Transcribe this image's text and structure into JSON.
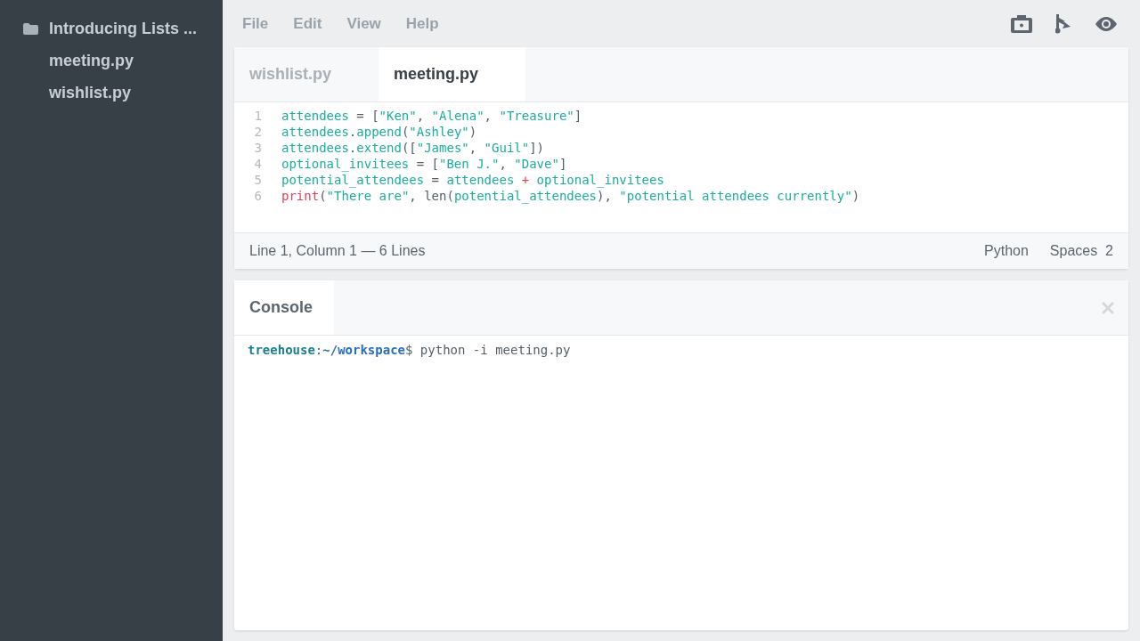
{
  "sidebar": {
    "folder": "Introducing Lists ...",
    "files": [
      {
        "label": "meeting.py",
        "selected": false
      },
      {
        "label": "wishlist.py",
        "selected": false
      }
    ]
  },
  "menu": [
    "File",
    "Edit",
    "View",
    "Help"
  ],
  "tabs": [
    {
      "label": "wishlist.py",
      "selected": false
    },
    {
      "label": "meeting.py",
      "selected": true
    }
  ],
  "code_lines": [
    {
      "number": "1",
      "tokens": [
        {
          "kind": "name",
          "text": "attendees"
        },
        {
          "kind": "punct",
          "text": " = ["
        },
        {
          "kind": "string",
          "text": "\"Ken\""
        },
        {
          "kind": "punct",
          "text": ", "
        },
        {
          "kind": "string",
          "text": "\"Alena\""
        },
        {
          "kind": "punct",
          "text": ", "
        },
        {
          "kind": "string",
          "text": "\"Treasure\""
        },
        {
          "kind": "punct",
          "text": "]"
        }
      ]
    },
    {
      "number": "2",
      "tokens": [
        {
          "kind": "name",
          "text": "attendees"
        },
        {
          "kind": "punct",
          "text": "."
        },
        {
          "kind": "name",
          "text": "append"
        },
        {
          "kind": "punct",
          "text": "("
        },
        {
          "kind": "string",
          "text": "\"Ashley\""
        },
        {
          "kind": "punct",
          "text": ")"
        }
      ]
    },
    {
      "number": "3",
      "tokens": [
        {
          "kind": "name",
          "text": "attendees"
        },
        {
          "kind": "punct",
          "text": "."
        },
        {
          "kind": "name",
          "text": "extend"
        },
        {
          "kind": "punct",
          "text": "(["
        },
        {
          "kind": "string",
          "text": "\"James\""
        },
        {
          "kind": "punct",
          "text": ", "
        },
        {
          "kind": "string",
          "text": "\"Guil\""
        },
        {
          "kind": "punct",
          "text": "])"
        }
      ]
    },
    {
      "number": "4",
      "tokens": [
        {
          "kind": "name",
          "text": "optional_invitees"
        },
        {
          "kind": "punct",
          "text": " = ["
        },
        {
          "kind": "string",
          "text": "\"Ben J.\""
        },
        {
          "kind": "punct",
          "text": ", "
        },
        {
          "kind": "string",
          "text": "\"Dave\""
        },
        {
          "kind": "punct",
          "text": "]"
        }
      ]
    },
    {
      "number": "5",
      "tokens": [
        {
          "kind": "name",
          "text": "potential_attendees"
        },
        {
          "kind": "punct",
          "text": " = "
        },
        {
          "kind": "name",
          "text": "attendees"
        },
        {
          "kind": "keyword",
          "text": " + "
        },
        {
          "kind": "name",
          "text": "optional_invitees"
        }
      ]
    },
    {
      "number": "6",
      "tokens": [
        {
          "kind": "keyword",
          "text": "print"
        },
        {
          "kind": "punct",
          "text": "("
        },
        {
          "kind": "string",
          "text": "\"There are\""
        },
        {
          "kind": "punct",
          "text": ", len("
        },
        {
          "kind": "name",
          "text": "potential_attendees"
        },
        {
          "kind": "punct",
          "text": "), "
        },
        {
          "kind": "string",
          "text": "\"potential attendees currently\""
        },
        {
          "kind": "punct",
          "text": ")"
        }
      ]
    }
  ],
  "status_bar": {
    "position": "Line 1, Column 1 — 6 Lines",
    "language": "Python",
    "indent": "Spaces  2"
  },
  "console": {
    "title": "Console",
    "user": "treehouse",
    "separator": ":",
    "path": "~/workspace",
    "command": "$ python -i meeting.py"
  }
}
